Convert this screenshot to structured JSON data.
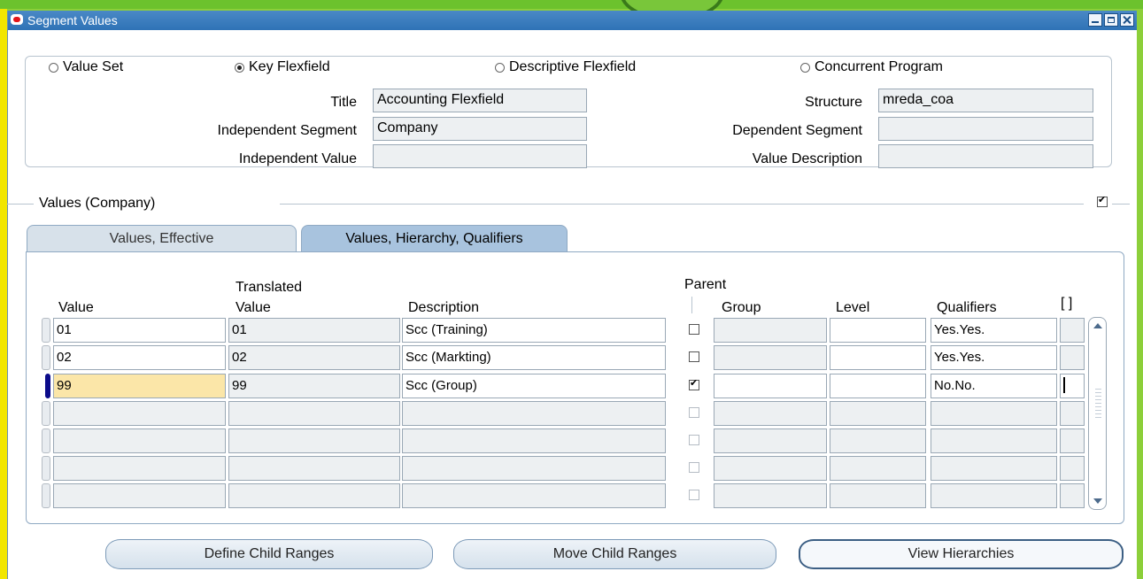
{
  "window": {
    "title": "Segment Values"
  },
  "scope": {
    "options": [
      {
        "label": "Value Set",
        "selected": false
      },
      {
        "label": "Key Flexfield",
        "selected": true
      },
      {
        "label": "Descriptive Flexfield",
        "selected": false
      },
      {
        "label": "Concurrent Program",
        "selected": false
      }
    ],
    "fields": {
      "title": {
        "label": "Title",
        "value": "Accounting Flexfield"
      },
      "structure": {
        "label": "Structure",
        "value": "mreda_coa"
      },
      "independent_segment": {
        "label": "Independent Segment",
        "value": "Company"
      },
      "dependent_segment": {
        "label": "Dependent Segment",
        "value": ""
      },
      "independent_value": {
        "label": "Independent Value",
        "value": ""
      },
      "value_description": {
        "label": "Value Description",
        "value": ""
      }
    }
  },
  "values": {
    "section_label": "Values (Company)",
    "section_checked": true,
    "tabs": [
      {
        "label": "Values, Effective",
        "active": false
      },
      {
        "label": "Values, Hierarchy, Qualifiers",
        "active": true
      }
    ],
    "headers": {
      "value": "Value",
      "translated_top": "Translated",
      "translated_bottom": "Value",
      "description": "Description",
      "parent": "Parent",
      "group": "Group",
      "level": "Level",
      "qualifiers": "Qualifiers",
      "extra": "[ ]"
    },
    "rows": [
      {
        "value": "01",
        "translated": "01",
        "description": "Scc (Training)",
        "parent": false,
        "group": "",
        "level": "",
        "qualifiers": "Yes.Yes."
      },
      {
        "value": "02",
        "translated": "02",
        "description": "Scc (Markting)",
        "parent": false,
        "group": "",
        "level": "",
        "qualifiers": "Yes.Yes."
      },
      {
        "value": "99",
        "translated": "99",
        "description": "Scc (Group)",
        "parent": true,
        "group": "",
        "level": "",
        "qualifiers": "No.No."
      },
      {
        "value": "",
        "translated": "",
        "description": "",
        "parent": false,
        "group": "",
        "level": "",
        "qualifiers": ""
      },
      {
        "value": "",
        "translated": "",
        "description": "",
        "parent": false,
        "group": "",
        "level": "",
        "qualifiers": ""
      },
      {
        "value": "",
        "translated": "",
        "description": "",
        "parent": false,
        "group": "",
        "level": "",
        "qualifiers": ""
      },
      {
        "value": "",
        "translated": "",
        "description": "",
        "parent": false,
        "group": "",
        "level": "",
        "qualifiers": ""
      }
    ]
  },
  "buttons": {
    "define_child_ranges": "Define Child Ranges",
    "move_child_ranges": "Move Child Ranges",
    "view_hierarchies": "View Hierarchies"
  }
}
